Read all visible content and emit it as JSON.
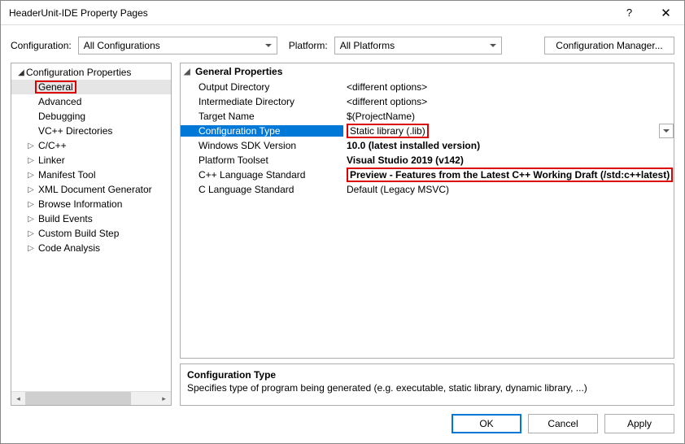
{
  "window": {
    "title": "HeaderUnit-IDE Property Pages"
  },
  "configRow": {
    "configurationLabel": "Configuration:",
    "configurationValue": "All Configurations",
    "platformLabel": "Platform:",
    "platformValue": "All Platforms",
    "configMgr": "Configuration Manager..."
  },
  "tree": {
    "root": "Configuration Properties",
    "items": [
      {
        "label": "General",
        "selected": true,
        "highlight": true
      },
      {
        "label": "Advanced"
      },
      {
        "label": "Debugging"
      },
      {
        "label": "VC++ Directories"
      },
      {
        "label": "C/C++",
        "expandable": true
      },
      {
        "label": "Linker",
        "expandable": true
      },
      {
        "label": "Manifest Tool",
        "expandable": true
      },
      {
        "label": "XML Document Generator",
        "expandable": true
      },
      {
        "label": "Browse Information",
        "expandable": true
      },
      {
        "label": "Build Events",
        "expandable": true
      },
      {
        "label": "Custom Build Step",
        "expandable": true
      },
      {
        "label": "Code Analysis",
        "expandable": true
      }
    ]
  },
  "grid": {
    "header": "General Properties",
    "rows": [
      {
        "label": "Output Directory",
        "value": "<different options>"
      },
      {
        "label": "Intermediate Directory",
        "value": "<different options>"
      },
      {
        "label": "Target Name",
        "value": "$(ProjectName)"
      },
      {
        "label": "Configuration Type",
        "value": "Static library (.lib)",
        "selected": true,
        "highlightVal": true
      },
      {
        "label": "Windows SDK Version",
        "value": "10.0 (latest installed version)",
        "bold": true
      },
      {
        "label": "Platform Toolset",
        "value": "Visual Studio 2019 (v142)",
        "bold": true
      },
      {
        "label": "C++ Language Standard",
        "value": "Preview - Features from the Latest C++ Working Draft (/std:c++latest)",
        "bold": true,
        "highlightVal": true
      },
      {
        "label": "C Language Standard",
        "value": "Default (Legacy MSVC)"
      }
    ]
  },
  "desc": {
    "title": "Configuration Type",
    "text": "Specifies type of program being generated (e.g. executable, static library, dynamic library, ...)"
  },
  "buttons": {
    "ok": "OK",
    "cancel": "Cancel",
    "apply": "Apply"
  }
}
